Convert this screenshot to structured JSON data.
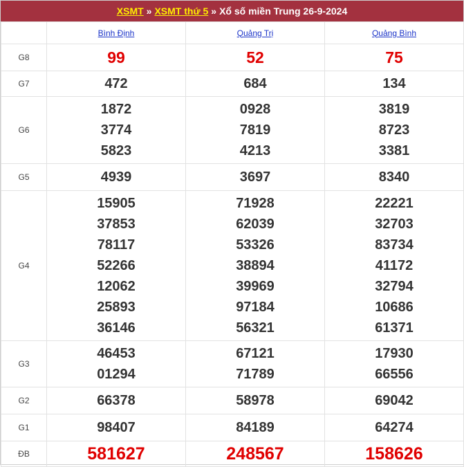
{
  "header": {
    "link1": "XSMT",
    "sep1": "»",
    "link2": "XSMT thứ 5",
    "sep2": "»",
    "rest": "Xổ số miền Trung 26-9-2024",
    "accent_color": "#a3313f",
    "link_color": "#ffee00"
  },
  "provinces": [
    "Bình Định",
    "Quảng Trị",
    "Quảng Bình"
  ],
  "prizes": {
    "G8": {
      "label": "G8",
      "values": [
        [
          "99"
        ],
        [
          "52"
        ],
        [
          "75"
        ]
      ]
    },
    "G7": {
      "label": "G7",
      "values": [
        [
          "472"
        ],
        [
          "684"
        ],
        [
          "134"
        ]
      ]
    },
    "G6": {
      "label": "G6",
      "values": [
        [
          "1872",
          "3774",
          "5823"
        ],
        [
          "0928",
          "7819",
          "4213"
        ],
        [
          "3819",
          "8723",
          "3381"
        ]
      ]
    },
    "G5": {
      "label": "G5",
      "values": [
        [
          "4939"
        ],
        [
          "3697"
        ],
        [
          "8340"
        ]
      ]
    },
    "G4": {
      "label": "G4",
      "values": [
        [
          "15905",
          "37853",
          "78117",
          "52266",
          "12062",
          "25893",
          "36146"
        ],
        [
          "71928",
          "62039",
          "53326",
          "38894",
          "39969",
          "97184",
          "56321"
        ],
        [
          "22221",
          "32703",
          "83734",
          "41172",
          "32794",
          "10686",
          "61371"
        ]
      ]
    },
    "G3": {
      "label": "G3",
      "values": [
        [
          "46453",
          "01294"
        ],
        [
          "67121",
          "71789"
        ],
        [
          "17930",
          "66556"
        ]
      ]
    },
    "G2": {
      "label": "G2",
      "values": [
        [
          "66378"
        ],
        [
          "58978"
        ],
        [
          "69042"
        ]
      ]
    },
    "G1": {
      "label": "G1",
      "values": [
        [
          "98407"
        ],
        [
          "84189"
        ],
        [
          "64274"
        ]
      ]
    },
    "DB": {
      "label": "ĐB",
      "values": [
        [
          "581627"
        ],
        [
          "248567"
        ],
        [
          "158626"
        ]
      ]
    }
  }
}
